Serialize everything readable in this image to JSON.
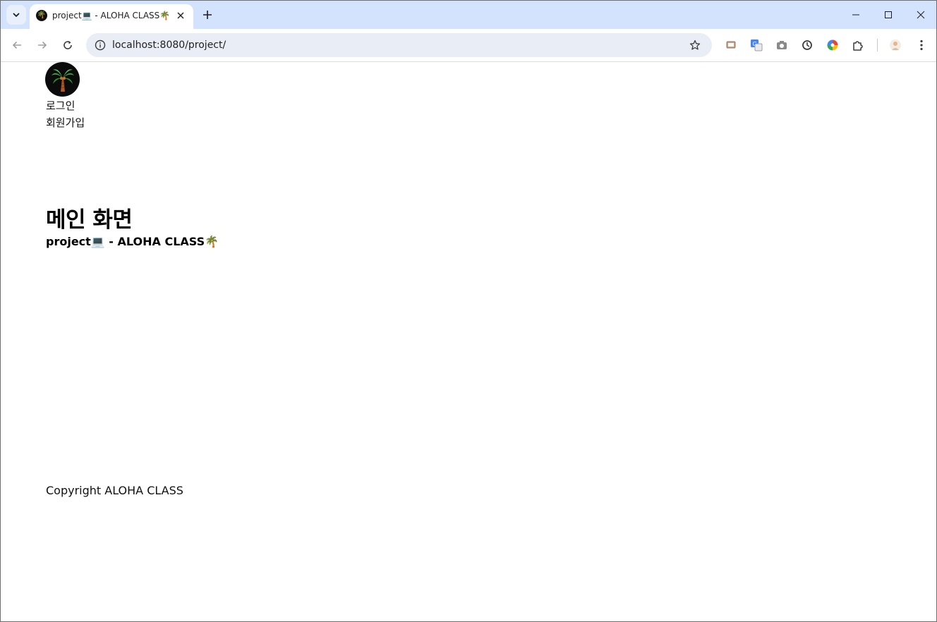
{
  "browser": {
    "tab": {
      "title": "project💻 - ALOHA CLASS🌴",
      "favicon": "palm-tree-icon"
    },
    "address_bar": {
      "url": "localhost:8080/project/"
    },
    "extensions": [
      "cast-icon",
      "translate-icon",
      "camera-icon",
      "sync-icon",
      "color-picker-icon",
      "puzzle-icon",
      "profile-avatar"
    ]
  },
  "page": {
    "logo_icon": "palm-tree-icon",
    "nav": {
      "login": "로그인",
      "signup": "회원가입"
    },
    "main": {
      "title": "메인 화면",
      "subtitle": "project💻 - ALOHA CLASS🌴"
    },
    "footer": {
      "text": "Copyright ALOHA CLASS"
    }
  }
}
